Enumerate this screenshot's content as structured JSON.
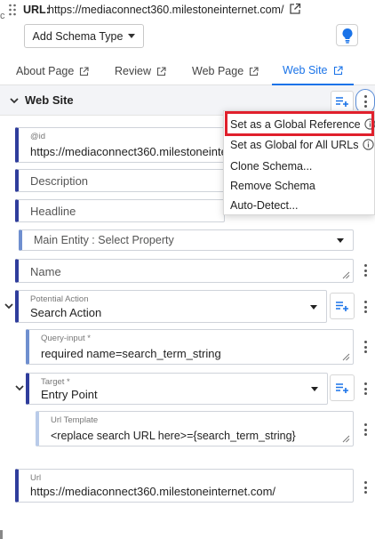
{
  "header": {
    "url_label": "URL:",
    "url_value": "https://mediaconnect360.milestoneinternet.com/",
    "left_edge_char": "c"
  },
  "toolbar": {
    "add_schema_label": "Add Schema Type",
    "bulb_icon": "lightbulb-icon",
    "accent_color": "#1a73e8"
  },
  "tabs": [
    {
      "label": "About Page",
      "active": false
    },
    {
      "label": "Review",
      "active": false
    },
    {
      "label": "Web Page",
      "active": false
    },
    {
      "label": "Web Site",
      "active": true
    }
  ],
  "section": {
    "title": "Web Site"
  },
  "menu": {
    "items": [
      {
        "label": "Set as a Global Reference",
        "info": true,
        "highlighted": true
      },
      {
        "label": "Set as Global for All URLs",
        "info": true
      },
      {
        "label": "Clone Schema..."
      },
      {
        "label": "Remove Schema"
      },
      {
        "label": "Auto-Detect..."
      }
    ],
    "highlight_color": "#e0202c"
  },
  "fields": {
    "id": {
      "label": "@id",
      "value": "https://mediaconnect360.milestoneinternet.com/"
    },
    "description": {
      "placeholder": "Description"
    },
    "headline": {
      "placeholder": "Headline"
    },
    "main_entity": {
      "placeholder": "Main Entity : Select Property"
    },
    "name": {
      "placeholder": "Name"
    },
    "potential_action": {
      "label": "Potential Action",
      "value": "Search Action"
    },
    "query_input": {
      "label": "Query-input *",
      "value": "required name=search_term_string"
    },
    "target": {
      "label": "Target *",
      "value": "Entry Point"
    },
    "url_template": {
      "label": "Url Template",
      "value": "<replace search URL here>={search_term_string}"
    },
    "url": {
      "label": "Url",
      "value": "https://mediaconnect360.milestoneinternet.com/"
    }
  }
}
